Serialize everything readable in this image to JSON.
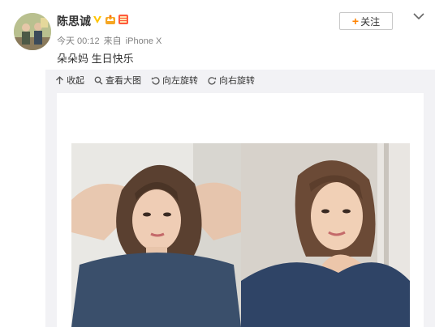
{
  "post": {
    "username": "陈思诚",
    "time": "今天 00:12",
    "source_prefix": "来自",
    "source": "iPhone X",
    "text": "朵朵妈 生日快乐"
  },
  "follow": {
    "label": "关注",
    "plus": "+"
  },
  "toolbar": {
    "collapse": "收起",
    "view_large": "查看大图",
    "rotate_left": "向左旋转",
    "rotate_right": "向右旋转"
  },
  "colors": {
    "accent": "#ff8200",
    "panel": "#f2f2f5",
    "meta": "#808080"
  },
  "icons": [
    "verified-v-icon",
    "member-crown-icon",
    "level-badge-icon",
    "chevron-down-icon",
    "collapse-icon",
    "magnifier-icon",
    "rotate-left-icon",
    "rotate-right-icon"
  ]
}
